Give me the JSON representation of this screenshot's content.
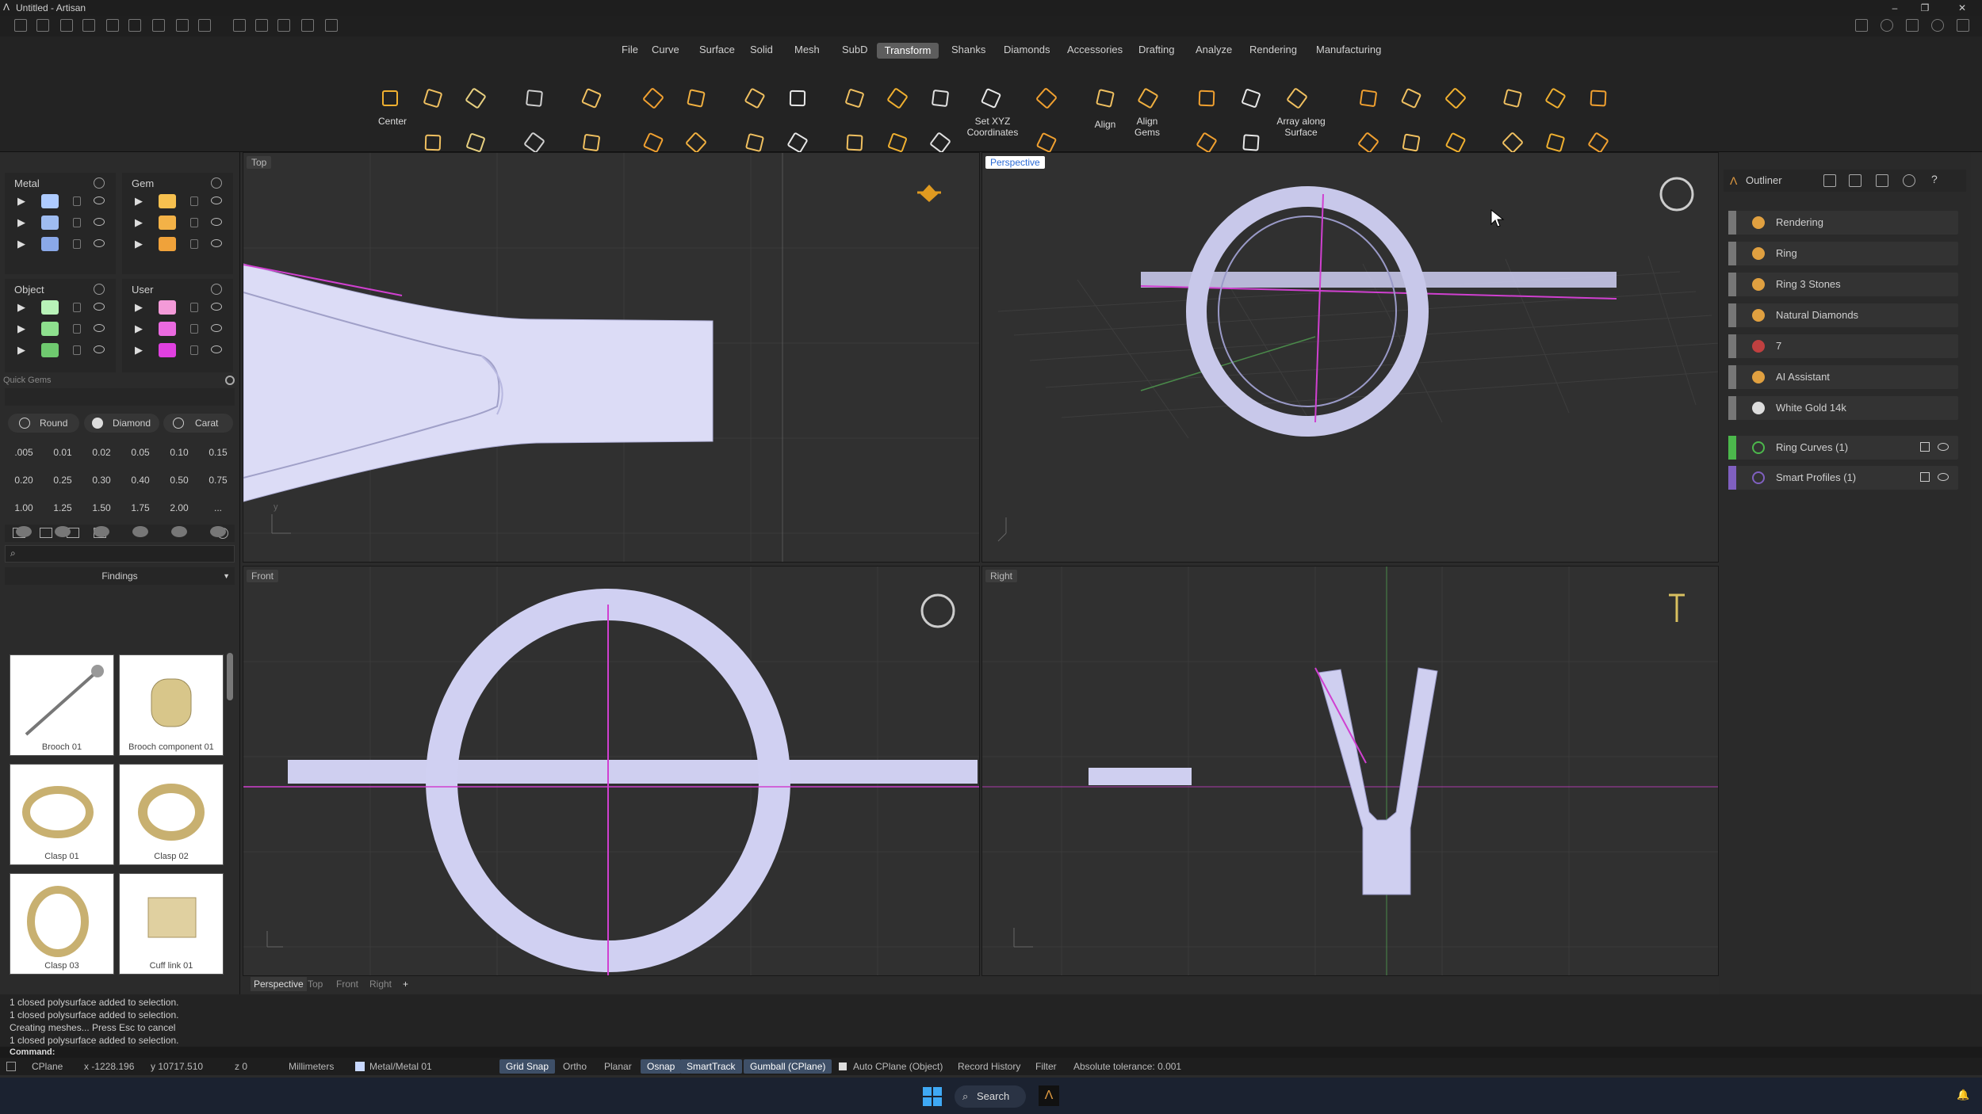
{
  "window": {
    "title": "Untitled - Artisan"
  },
  "menus": [
    "File",
    "Curve",
    "Surface",
    "Solid",
    "Mesh",
    "SubD",
    "Transform",
    "Shanks",
    "Diamonds",
    "Accessories",
    "Drafting",
    "Analyze",
    "Rendering",
    "Manufacturing"
  ],
  "active_menu": "Transform",
  "toolbar_labels": {
    "center": "Center",
    "set_xyz": "Set XYZ Coordinates",
    "align": "Align",
    "align_gems": "Align Gems",
    "array_surface": "Array along Surface"
  },
  "layers": {
    "metal": "Metal",
    "gem": "Gem",
    "object": "Object",
    "user": "User",
    "metal_colors": [
      "#aecbff",
      "#9fbcf0",
      "#8aa8e8"
    ],
    "gem_colors": [
      "#f6c04f",
      "#f3b247",
      "#f0a23a"
    ],
    "object_colors": [
      "#b8f2b8",
      "#8ee08e",
      "#6fc96f"
    ],
    "user_colors": [
      "#f39ad8",
      "#ea6ae0",
      "#e040e0"
    ]
  },
  "quick_gems": {
    "title": "Quick Gems",
    "shape": "Round",
    "material": "Diamond",
    "unit": "Carat",
    "sizes": [
      ".005",
      "0.01",
      "0.02",
      "0.05",
      "0.10",
      "0.15",
      "0.20",
      "0.25",
      "0.30",
      "0.40",
      "0.50",
      "0.75",
      "1.00",
      "1.25",
      "1.50",
      "1.75",
      "2.00",
      "..."
    ]
  },
  "library": {
    "category": "Findings",
    "items": [
      "Brooch 01",
      "Brooch component 01",
      "Clasp 01",
      "Clasp 02",
      "Clasp 03",
      "Cuff link 01"
    ]
  },
  "viewports": {
    "top": "Top",
    "perspective": "Perspective",
    "front": "Front",
    "right": "Right"
  },
  "viewport_tabs": [
    "Perspective",
    "Top",
    "Front",
    "Right"
  ],
  "outliner": {
    "title": "Outliner",
    "items": [
      "Rendering",
      "Ring",
      "Ring 3 Stones",
      "Natural Diamonds",
      "7",
      "AI Assistant",
      "White Gold 14k"
    ],
    "layers": [
      "Ring Curves (1)",
      "Smart Profiles (1)"
    ]
  },
  "command_history": [
    "1 closed polysurface added to selection.",
    "1 closed polysurface added to selection.",
    "Creating meshes... Press Esc to cancel",
    "1 closed polysurface added to selection.",
    "1 closed polysurface added to selection."
  ],
  "command_prompt": "Command:",
  "status": {
    "cplane": "CPlane",
    "x": "x -1228.196",
    "y": "y 10717.510",
    "z": "z 0",
    "units": "Millimeters",
    "layer": "Metal/Metal 01",
    "grid_snap": "Grid Snap",
    "ortho": "Ortho",
    "planar": "Planar",
    "osnap": "Osnap",
    "smarttrack": "SmartTrack",
    "gumball": "Gumball (CPlane)",
    "auto_cplane": "Auto CPlane (Object)",
    "record_history": "Record History",
    "filter": "Filter",
    "tolerance": "Absolute tolerance: 0.001"
  },
  "taskbar": {
    "search": "Search"
  }
}
